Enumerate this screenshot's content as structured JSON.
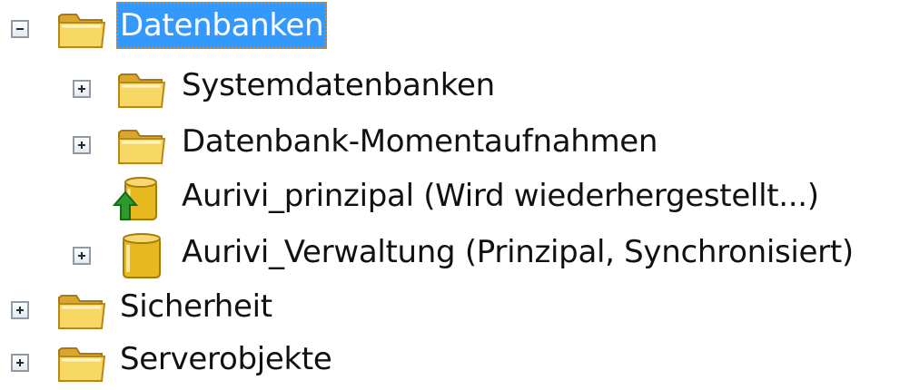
{
  "tree": {
    "nodes": [
      {
        "label": "Datenbanken",
        "toggle": "collapse",
        "icon": "folder-icon",
        "selected": true
      },
      {
        "label": "Systemdatenbanken",
        "toggle": "expand",
        "icon": "folder-icon"
      },
      {
        "label": "Datenbank-Momentaufnahmen",
        "toggle": "expand",
        "icon": "folder-icon"
      },
      {
        "label": "Aurivi_prinzipal (Wird wiederhergestellt...)",
        "toggle": "none",
        "icon": "database-restoring-icon"
      },
      {
        "label": "Aurivi_Verwaltung (Prinzipal, Synchronisiert)",
        "toggle": "expand",
        "icon": "database-icon"
      },
      {
        "label": "Sicherheit",
        "toggle": "expand",
        "icon": "folder-icon"
      },
      {
        "label": "Serverobjekte",
        "toggle": "expand",
        "icon": "folder-icon"
      }
    ]
  },
  "colors": {
    "selection": "#3399ff",
    "folder": "#f2cb4d",
    "database": "#e8b820",
    "restore_arrow": "#2e9a2e"
  }
}
